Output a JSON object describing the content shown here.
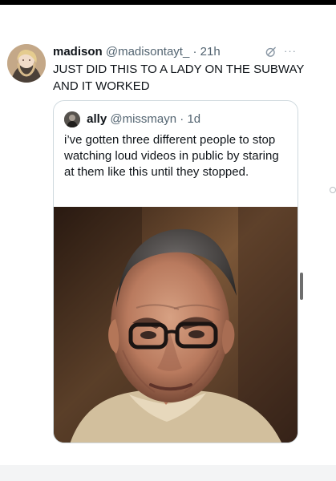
{
  "post": {
    "author_name": "madison",
    "author_handle": "@madisontayt_",
    "separator": "·",
    "time": "21h",
    "text": "JUST DID THIS TO A LADY ON THE SUBWAY AND IT WORKED",
    "icons": [
      "edited-icon",
      "more-options-icon"
    ]
  },
  "quote": {
    "author_name": "ally",
    "author_handle": "@missmayn",
    "separator": "·",
    "time": "1d",
    "text": "i’ve gotten three different people to stop watching loud videos in public by staring at them like this until they stopped.",
    "media": {
      "type": "photo"
    }
  },
  "colors": {
    "primary_text": "#0f1419",
    "secondary_text": "#536471",
    "border": "#cfd9de",
    "background": "#ffffff",
    "top_bar": "#000000"
  }
}
